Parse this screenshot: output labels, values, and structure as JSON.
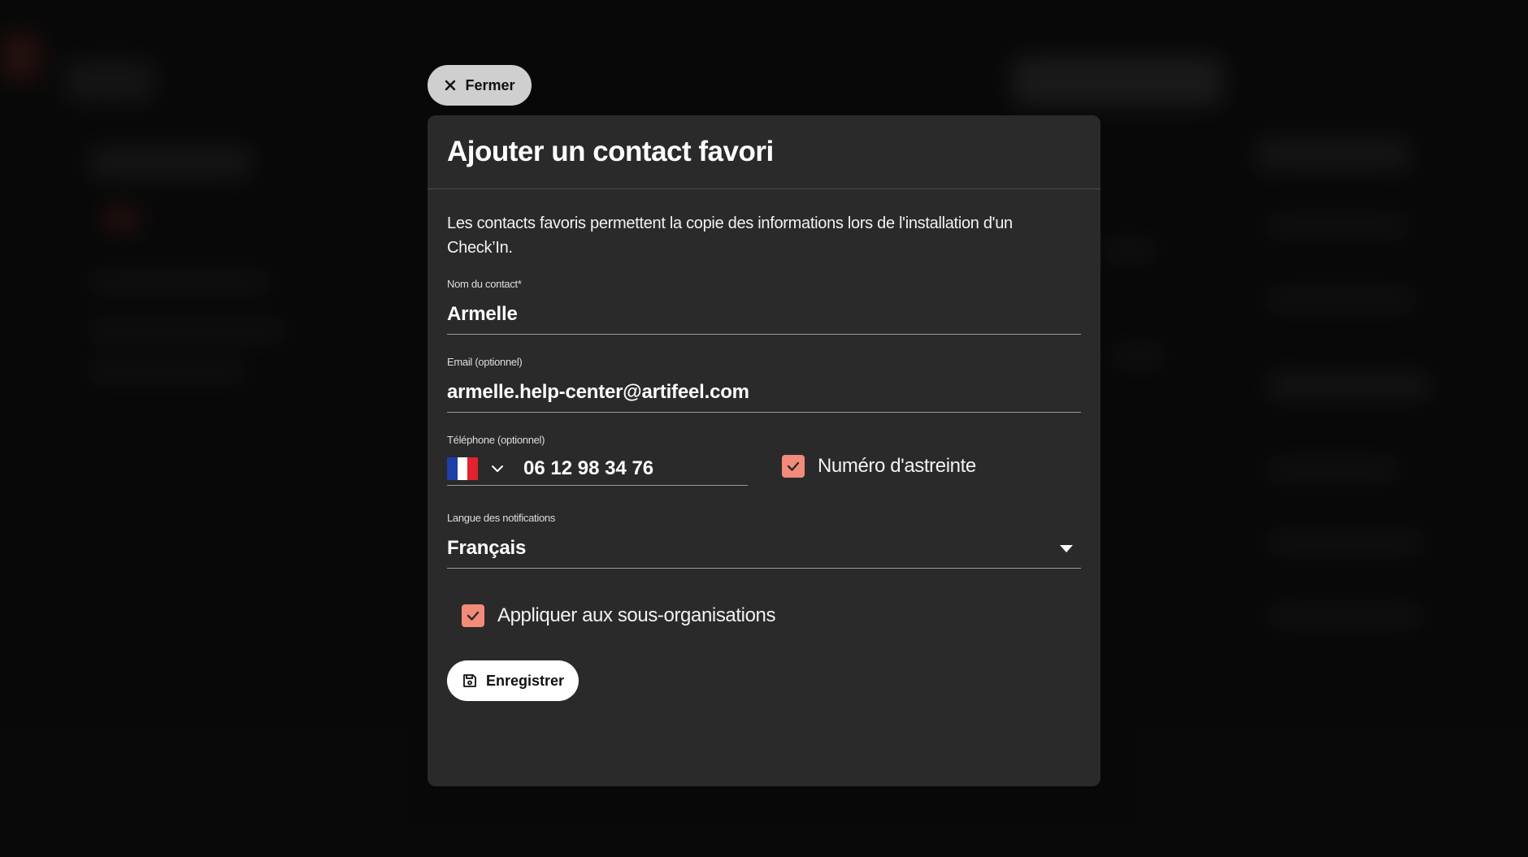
{
  "close_button": {
    "label": "Fermer",
    "icon": "close-icon"
  },
  "modal": {
    "title": "Ajouter un contact favori",
    "intro": "Les contacts favoris permettent la copie des informations lors de l'installation d'un Check’In.",
    "fields": {
      "name": {
        "label": "Nom du contact*",
        "value": "Armelle"
      },
      "email": {
        "label": "Email (optionnel)",
        "value": "armelle.help-center@artifeel.com"
      },
      "phone": {
        "label": "Téléphone (optionnel)",
        "country_flag": "france-flag-icon",
        "value": "06 12 98 34 76",
        "oncall_label": "Numéro d'astreinte",
        "oncall_checked": true
      },
      "language": {
        "label": "Langue des notifications",
        "value": "Français"
      }
    },
    "apply_sub_orgs": {
      "label": "Appliquer aux sous-organisations",
      "checked": true
    },
    "save_button": {
      "label": "Enregistrer",
      "icon": "save-icon"
    }
  },
  "colors": {
    "accent": "#f28b7a",
    "modal_bg": "#2a2a2a",
    "overlay": "#101010"
  }
}
